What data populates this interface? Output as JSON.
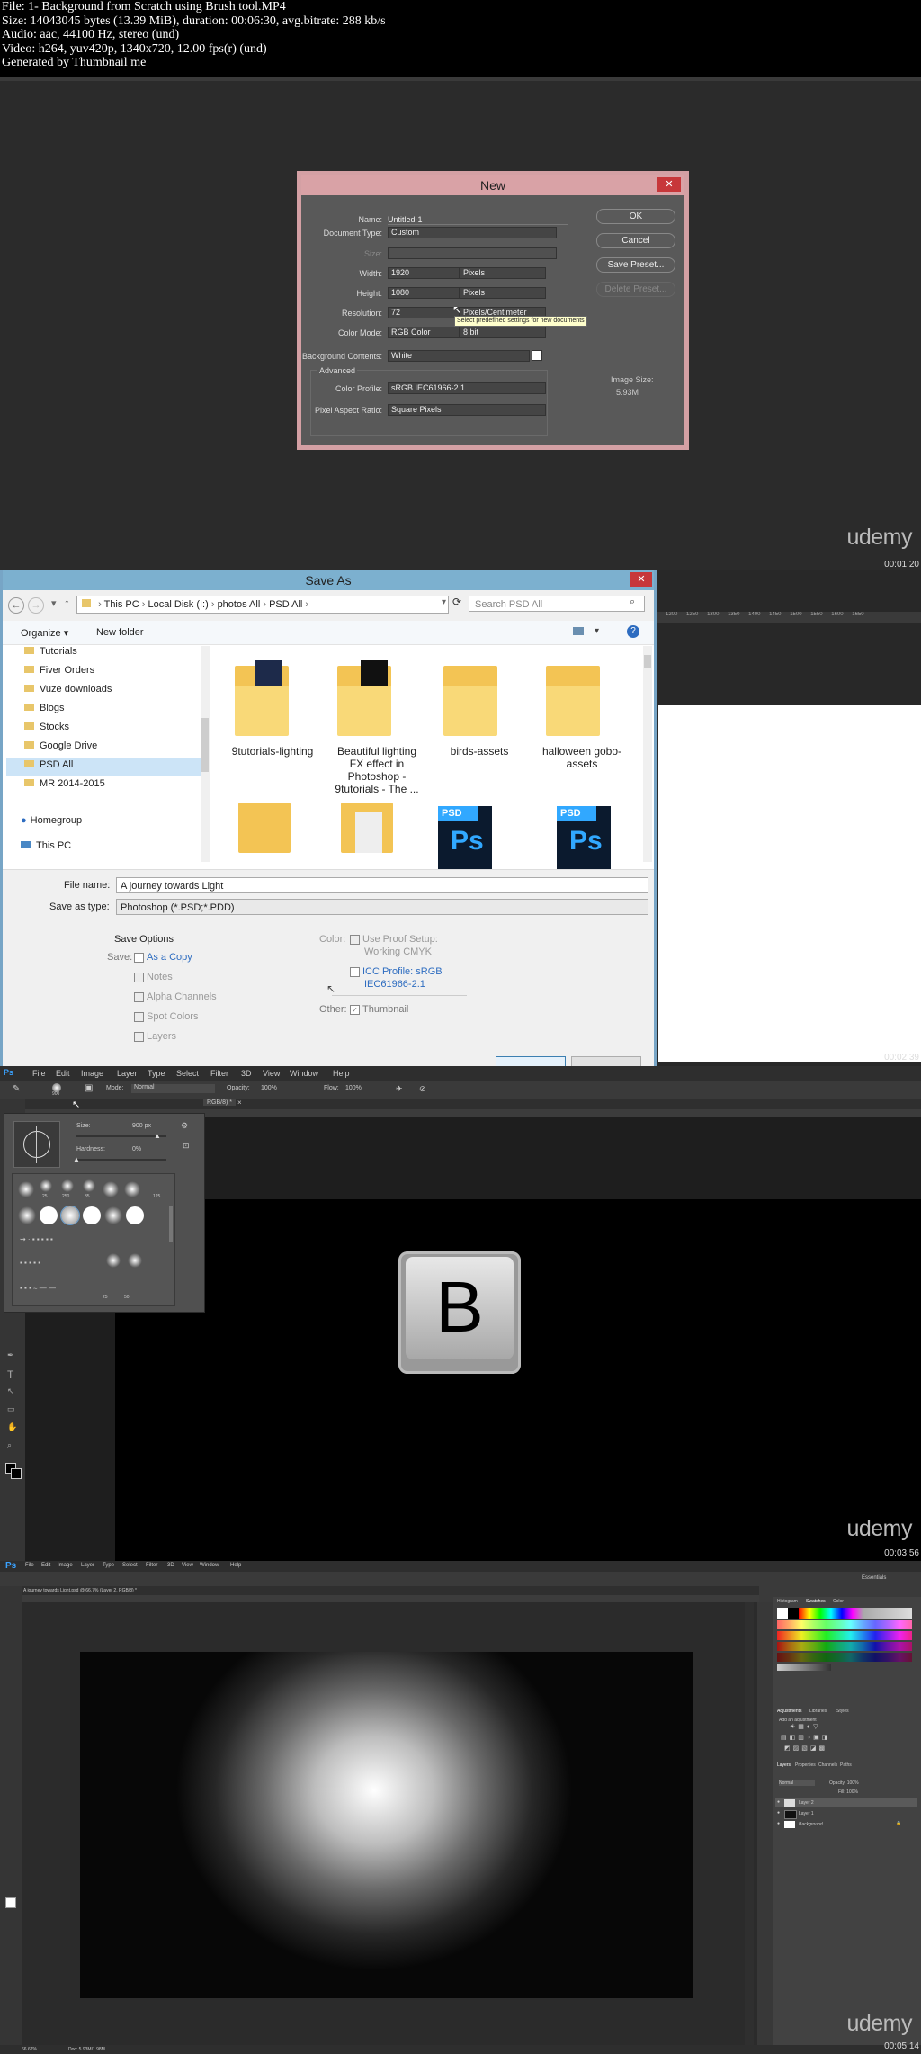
{
  "header": {
    "lines": [
      "File: 1- Background from Scratch using Brush tool.MP4",
      "Size: 14043045 bytes (13.39 MiB), duration: 00:06:30, avg.bitrate: 288 kb/s",
      "Audio: aac, 44100 Hz, stereo (und)",
      "Video: h264, yuv420p, 1340x720, 12.00 fps(r) (und)",
      "Generated by Thumbnail me"
    ]
  },
  "watermark": "udemy",
  "timestamps": [
    "00:01:20",
    "00:02:39",
    "00:03:56",
    "00:05:14"
  ],
  "new_dialog": {
    "title": "New",
    "close": "✕",
    "name_label": "Name:",
    "name_value": "Untitled-1",
    "doc_type_label": "Document Type:",
    "doc_type_value": "Custom",
    "size_label": "Size:",
    "width_label": "Width:",
    "width_value": "1920",
    "width_unit": "Pixels",
    "height_label": "Height:",
    "height_value": "1080",
    "height_unit": "Pixels",
    "resolution_label": "Resolution:",
    "resolution_value": "72",
    "resolution_unit": "Pixels/Centimeter",
    "tooltip": "Select predefined settings for new documents",
    "color_mode_label": "Color Mode:",
    "color_mode_value": "RGB Color",
    "bit_depth": "8 bit",
    "bg_label": "Background Contents:",
    "bg_value": "White",
    "advanced_label": "Advanced",
    "profile_label": "Color Profile:",
    "profile_value": "sRGB IEC61966-2.1",
    "aspect_label": "Pixel Aspect Ratio:",
    "aspect_value": "Square Pixels",
    "ok": "OK",
    "cancel": "Cancel",
    "save_preset": "Save Preset...",
    "delete_preset": "Delete Preset...",
    "image_size_label": "Image Size:",
    "image_size_value": "5.93M"
  },
  "save_as": {
    "title": "Save As",
    "close": "✕",
    "path": [
      "This PC",
      "Local Disk (I:)",
      "photos All",
      "PSD All"
    ],
    "search_placeholder": "Search PSD All",
    "organize": "Organize ▾",
    "new_folder": "New folder",
    "nav_items": [
      "Tutorials",
      "Fiver Orders",
      "Vuze downloads",
      "Blogs",
      "Stocks",
      "Google Drive",
      "PSD All",
      "MR 2014-2015"
    ],
    "homegroup": "Homegroup",
    "this_pc": "This PC",
    "files": [
      "9tutorials-lighting",
      "Beautiful lighting FX effect in Photoshop - 9tutorials - The ...",
      "birds-assets",
      "halloween gobo-assets"
    ],
    "psd_label": "PSD",
    "ps_label": "Ps",
    "file_name_label": "File name:",
    "file_name_value": "A journey towards Light",
    "save_type_label": "Save as type:",
    "save_type_value": "Photoshop (*.PSD;*.PDD)",
    "save_options": "Save Options",
    "save_label": "Save:",
    "as_copy": "As a Copy",
    "notes": "Notes",
    "alpha": "Alpha Channels",
    "spot": "Spot Colors",
    "layers": "Layers",
    "color_label": "Color:",
    "proof": "Use Proof Setup:",
    "working": "Working CMYK",
    "icc": "ICC Profile:  sRGB",
    "icc2": "IEC61966-2.1",
    "other_label": "Other:",
    "thumbnail": "Thumbnail"
  },
  "ruler_numbers": [
    "1200",
    "1250",
    "1300",
    "1350",
    "1400",
    "1450",
    "1500",
    "1550",
    "1600",
    "1650",
    "1700",
    "1750",
    "1800",
    "1850"
  ],
  "photoshop1": {
    "menu": [
      "File",
      "Edit",
      "Image",
      "Layer",
      "Type",
      "Select",
      "Filter",
      "3D",
      "View",
      "Window",
      "Help"
    ],
    "mode_label": "Mode:",
    "mode_value": "Normal",
    "opacity_label": "Opacity:",
    "opacity_value": "100%",
    "flow_label": "Flow:",
    "flow_value": "100%",
    "brush_size": "900",
    "size_label": "Size:",
    "size_value": "900 px",
    "hardness_label": "Hardness:",
    "hardness_value": "0%",
    "tab": "RGB/8) *",
    "tab_close": "×",
    "key_letter": "B",
    "preset_labels": [
      "25",
      "250",
      "35",
      "125",
      "25",
      "50"
    ]
  },
  "photoshop2": {
    "logo": "Ps",
    "menu": [
      "File",
      "Edit",
      "Image",
      "Layer",
      "Type",
      "Select",
      "Filter",
      "3D",
      "View",
      "Window",
      "Help"
    ],
    "doc_tab": "A journey towards Light.psd @ 66.7% (Layer 2, RGB/8) *",
    "essentials": "Essentials",
    "panel_tabs": [
      "Histogram",
      "Swatches",
      "Color"
    ],
    "adj_tabs": [
      "Adjustments",
      "Libraries",
      "Styles"
    ],
    "add_adjustment": "Add an adjustment",
    "layer_tabs": [
      "Layers",
      "Properties",
      "Channels",
      "Paths"
    ],
    "blend": "Normal",
    "opacity": "Opacity: 100%",
    "fill": "Fill: 100%",
    "layers": [
      "Layer 2",
      "Layer 1",
      "Background"
    ],
    "status": "66.67%",
    "doc_status": "Doc: 5.93M/1.98M"
  }
}
